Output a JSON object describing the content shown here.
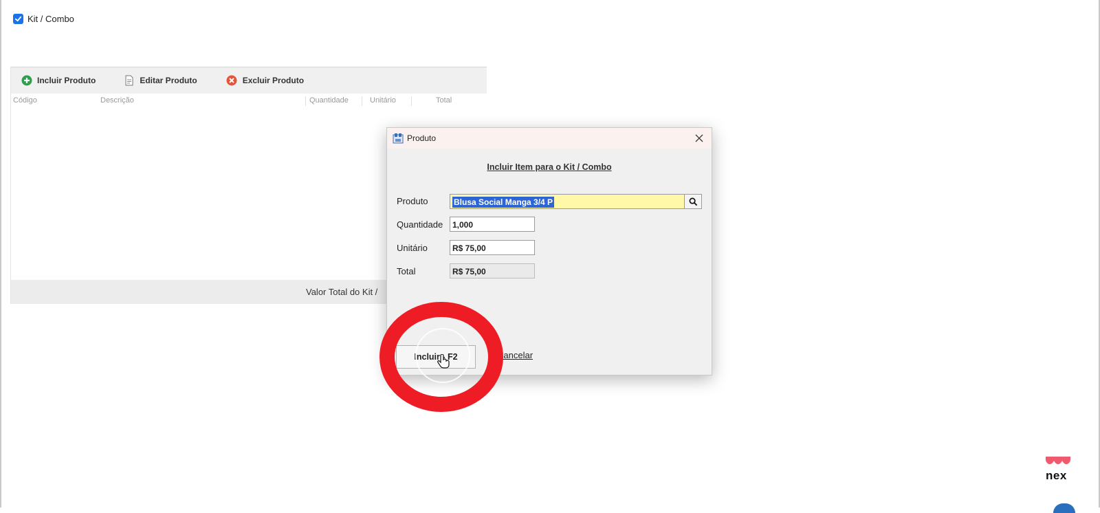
{
  "kit_checkbox": {
    "label": "Kit / Combo",
    "checked": true
  },
  "toolbar": {
    "incluir_label": "Incluir Produto",
    "editar_label": "Editar Produto",
    "excluir_label": "Excluir Produto"
  },
  "grid": {
    "columns": [
      "Código",
      "Descrição",
      "Quantidade",
      "Unitário",
      "Total"
    ],
    "footer_label": "Valor Total do Kit /"
  },
  "dialog": {
    "title": "Produto",
    "heading": "Incluir Item para o Kit / Combo",
    "fields": {
      "produto": {
        "label": "Produto",
        "value": "Blusa Social Manga 3/4 P"
      },
      "quantidade": {
        "label": "Quantidade",
        "value": "1,000"
      },
      "unitario": {
        "label": "Unitário",
        "value": "R$ 75,00"
      },
      "total": {
        "label": "Total",
        "value": "R$ 75,00"
      }
    },
    "incluir_button": "Incluir - F2",
    "cancelar_link": "Cancelar"
  },
  "brand": {
    "text": "nex",
    "color": "#f05a6e"
  },
  "colors": {
    "accent": "#1a73e8",
    "highlight_ring": "#ee1c24",
    "selection": "#2d66d4",
    "input_focus": "#fff8a8"
  }
}
